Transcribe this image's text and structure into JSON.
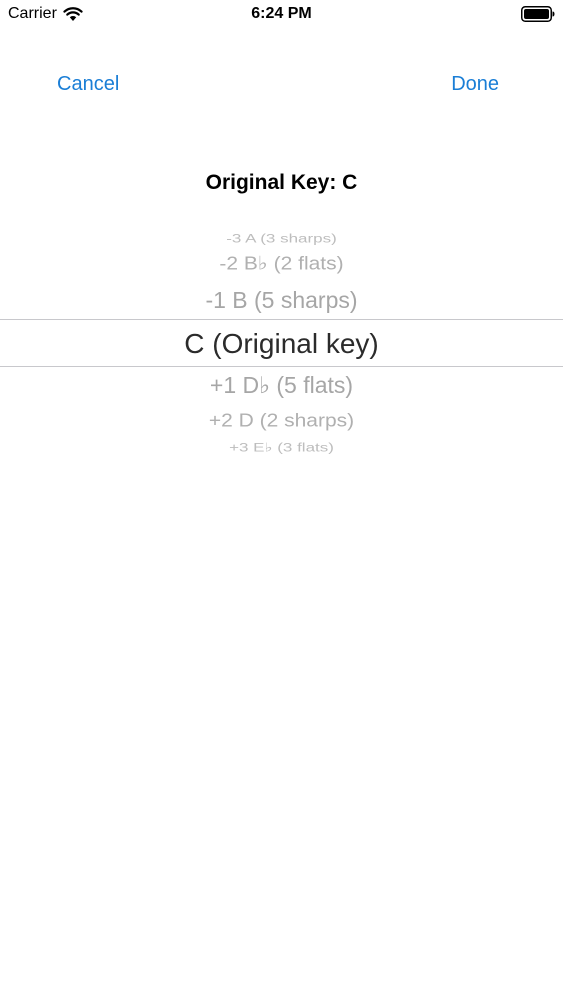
{
  "status_bar": {
    "carrier": "Carrier",
    "time": "6:24 PM",
    "icons": [
      "wifi-icon",
      "battery-icon"
    ]
  },
  "nav": {
    "cancel_label": "Cancel",
    "done_label": "Done",
    "accent_color": "#1a7ed6"
  },
  "picker": {
    "title": "Original Key: C",
    "selected_label": "C (Original key)",
    "rows_above": [
      "-3 A  (3 sharps)",
      "-2 B♭  (2 flats)",
      "-1 B  (5 sharps)"
    ],
    "rows_below": [
      "+1 D♭  (5 flats)",
      "+2 D  (2 sharps)",
      "+3 E♭  (3 flats)"
    ]
  }
}
